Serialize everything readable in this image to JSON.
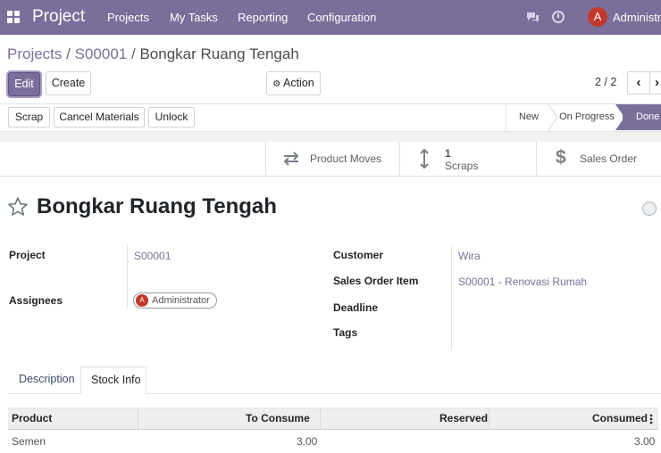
{
  "navbar": {
    "brand": "Project",
    "menu": [
      "Projects",
      "My Tasks",
      "Reporting",
      "Configuration"
    ],
    "avatar_letter": "A",
    "user": "Administra",
    "color": "#7c6e9b"
  },
  "breadcrumb": {
    "items": [
      "Projects",
      "S00001"
    ],
    "separator": "/",
    "current": "Bongkar Ruang Tengah"
  },
  "controls": {
    "edit": "Edit",
    "create": "Create",
    "action": "Action",
    "pager": "2 / 2"
  },
  "statusbar": {
    "buttons": [
      "Scrap",
      "Cancel Materials",
      "Unlock"
    ],
    "stages": [
      "New",
      "On Progress",
      "Done"
    ],
    "active_stage": "Done"
  },
  "smart_buttons": {
    "product_moves": "Product Moves",
    "scraps_count": "1",
    "scraps": "Scraps",
    "sales_order": "Sales Order"
  },
  "record": {
    "title": "Bongkar Ruang Tengah",
    "left_fields": {
      "project_label": "Project",
      "project_value": "S00001",
      "assignees_label": "Assignees",
      "assignee_letter": "A",
      "assignee": "Administrator"
    },
    "right_fields": {
      "customer_label": "Customer",
      "customer_value": "Wira",
      "soi_label": "Sales Order Item",
      "soi_value": "S00001 - Renovasi Rumah",
      "deadline_label": "Deadline",
      "tags_label": "Tags"
    }
  },
  "tabs": [
    "Description",
    "Stock Info"
  ],
  "active_tab": "Stock Info",
  "table": {
    "columns": [
      "Product",
      "To Consume",
      "Reserved",
      "Consumed"
    ],
    "rows": [
      {
        "product": "Semen",
        "to_consume": "3.00",
        "reserved": "",
        "consumed": "3.00"
      }
    ]
  }
}
